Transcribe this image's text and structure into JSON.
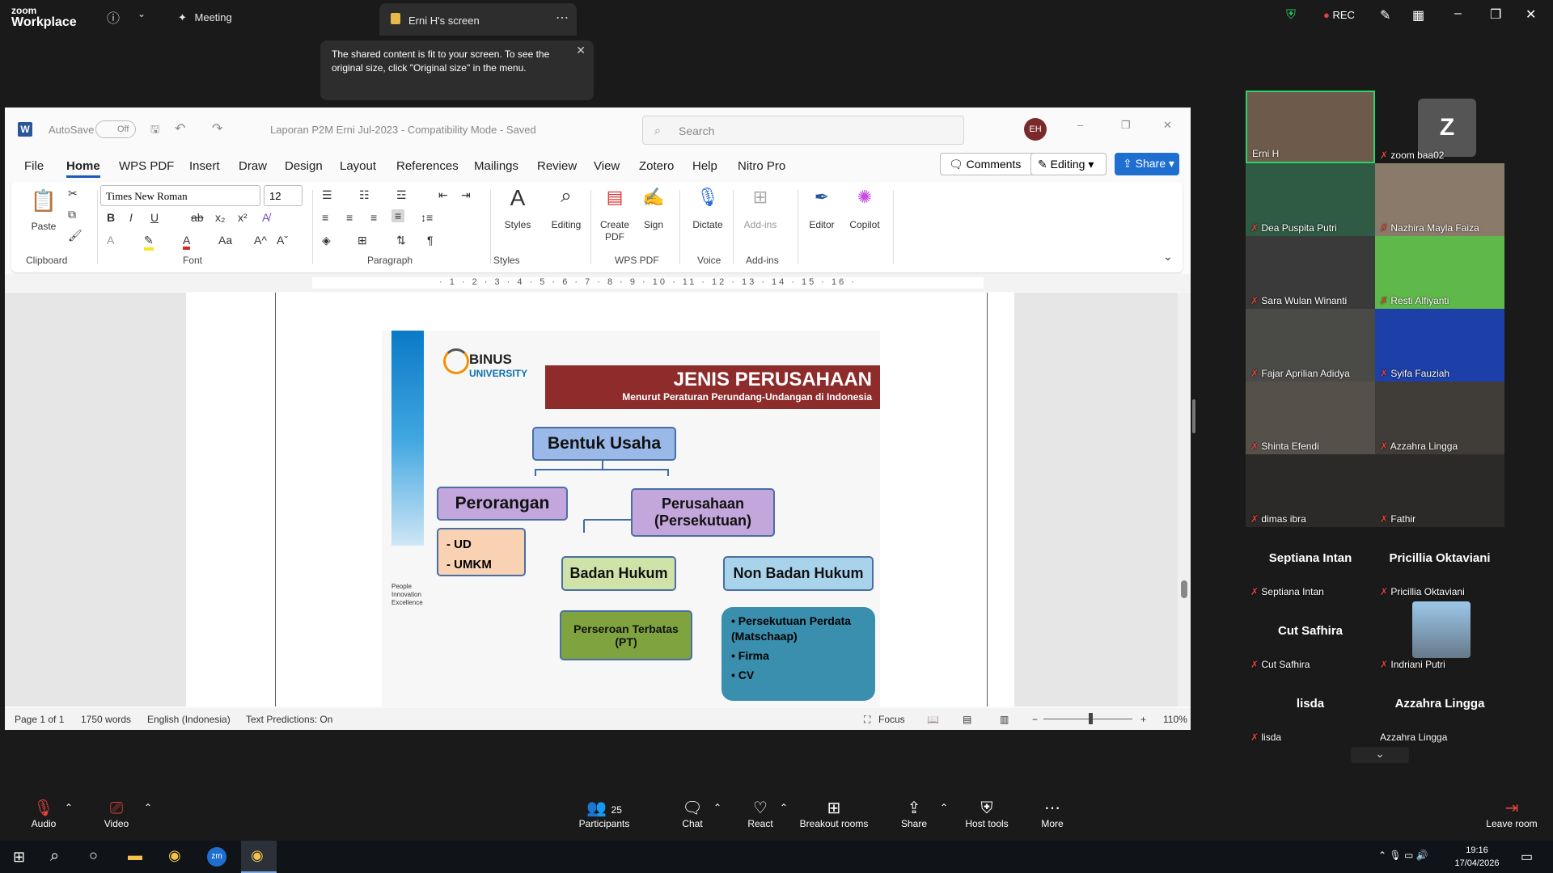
{
  "zoom": {
    "brand_top": "zoom",
    "brand_bottom": "Workplace",
    "meeting_label": "Meeting",
    "share_tab": "Erni H's screen",
    "rec": "REC",
    "tooltip": "The shared content is fit to your screen. To see the original size, click \"Original size\" in the menu."
  },
  "word": {
    "autosave": "AutoSave",
    "autosave_state": "Off",
    "title": "Laporan P2M Erni Jul-2023  -  Compatibility Mode  -  Saved",
    "search_placeholder": "Search",
    "avatar": "EH",
    "menu": [
      "File",
      "Home",
      "WPS PDF",
      "Insert",
      "Draw",
      "Design",
      "Layout",
      "References",
      "Mailings",
      "Review",
      "View",
      "Zotero",
      "Help",
      "Nitro Pro"
    ],
    "comments": "Comments",
    "editing": "Editing",
    "share": "Share",
    "font_name": "Times New Roman",
    "font_size": "12",
    "ribbon": {
      "paste": "Paste",
      "styles": "Styles",
      "editing": "Editing",
      "create_pdf": "Create PDF",
      "sign": "Sign",
      "dictate": "Dictate",
      "addins": "Add-ins",
      "editor": "Editor",
      "copilot": "Copilot"
    },
    "groups": {
      "clipboard": "Clipboard",
      "font": "Font",
      "paragraph": "Paragraph",
      "styles": "Styles",
      "wps": "WPS PDF",
      "voice": "Voice",
      "addins": "Add-ins"
    },
    "ruler": "· 1 · 2 · 3 · 4 · 5 · 6 · 7 · 8 · 9 · 10 · 11 · 12 · 13 · 14 · 15 · 16 ·",
    "status": {
      "page": "Page 1 of 1",
      "words": "1750 words",
      "lang": "English (Indonesia)",
      "pred": "Text Predictions: On",
      "focus": "Focus",
      "zoom": "110%"
    }
  },
  "slide": {
    "logo1": "BINUS",
    "logo2": "UNIVERSITY",
    "tagline": "People Innovation Excellence",
    "title": "JENIS PERUSAHAAN",
    "subtitle": "Menurut Peraturan Perundang-Undangan di Indonesia",
    "bentuk": "Bentuk Usaha",
    "perorangan": "Perorangan",
    "persekutuan": "Perusahaan (Persekutuan)",
    "ud": "-  UD",
    "umkm": "-  UMKM",
    "badan": "Badan Hukum",
    "nonbadan": "Non Badan Hukum",
    "pt": "Perseroan Terbatas (PT)",
    "nb1": "•  Persekutuan Perdata (Matschaap)",
    "nb2": "•  Firma",
    "nb3": "•  CV"
  },
  "participants": [
    {
      "name": "Erni H"
    },
    {
      "name": "zoom baa02",
      "initial": "Z"
    },
    {
      "name": "Dea Puspita Putri"
    },
    {
      "name": "Nazhira Mayla Faiza"
    },
    {
      "name": "Sara Wulan Winanti"
    },
    {
      "name": "Resti Alfiyanti"
    },
    {
      "name": "Fajar Aprilian Adidya"
    },
    {
      "name": "Syifa Fauziah"
    },
    {
      "name": "Shinta Efendi"
    },
    {
      "name": "Azzahra Lingga"
    },
    {
      "name": "dimas ibra"
    },
    {
      "name": "Fathir"
    },
    {
      "name": "Septiana Intan",
      "big": "Septiana Intan"
    },
    {
      "name": "Pricillia Oktaviani",
      "big": "Pricillia Oktaviani"
    },
    {
      "name": "Cut Safhira",
      "big": "Cut Safhira"
    },
    {
      "name": "Indriani Putri"
    },
    {
      "name": "lisda",
      "big": "lisda"
    },
    {
      "name": "Azzahra Lingga",
      "big": "Azzahra Lingga"
    }
  ],
  "controls": {
    "audio": "Audio",
    "video": "Video",
    "participants": "Participants",
    "participants_count": "25",
    "chat": "Chat",
    "react": "React",
    "breakout": "Breakout rooms",
    "share": "Share",
    "host": "Host tools",
    "more": "More",
    "leave": "Leave room"
  },
  "taskbar": {
    "time": "19:16",
    "date": "17/04/2026"
  }
}
